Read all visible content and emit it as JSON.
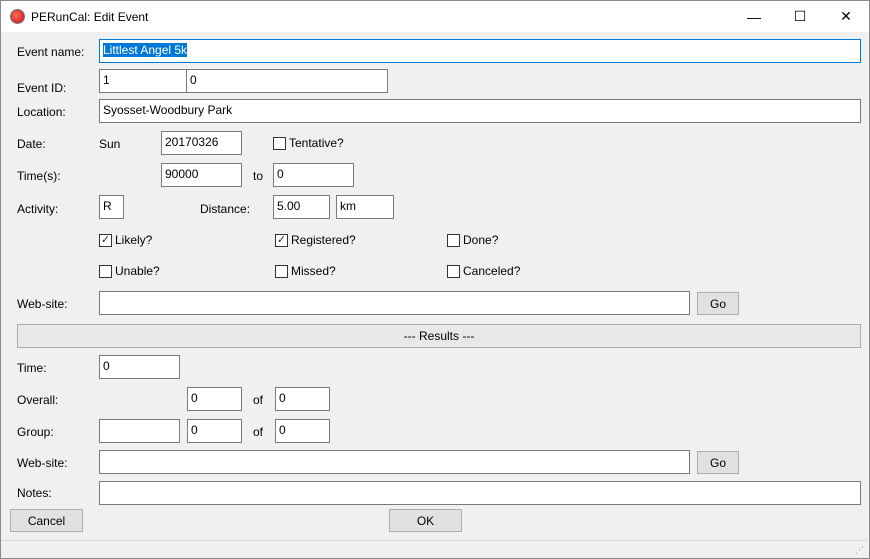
{
  "window": {
    "title": "PERunCal: Edit Event",
    "minimize": "—",
    "maximize": "☐",
    "close": "✕"
  },
  "form": {
    "event_name_label": "Event name:",
    "event_name": "Littlest Angel 5k",
    "event_id_label": "Event ID:",
    "event_id_1": "1",
    "event_id_2": "0",
    "location_label": "Location:",
    "location": "Syosset-Woodbury Park",
    "date_label": "Date:",
    "day": "Sun",
    "date": "20170326",
    "tentative": {
      "label": "Tentative?",
      "checked": false
    },
    "times_label": "Time(s):",
    "time_from": "90000",
    "to_label": "to",
    "time_to": "0",
    "activity_label": "Activity:",
    "activity": "R",
    "distance_label": "Distance:",
    "distance": "5.00",
    "unit": "km",
    "checkboxes": [
      {
        "label": "Likely?",
        "checked": true
      },
      {
        "label": "Registered?",
        "checked": true
      },
      {
        "label": "Done?",
        "checked": false
      },
      {
        "label": "Unable?",
        "checked": false
      },
      {
        "label": "Missed?",
        "checked": false
      },
      {
        "label": "Canceled?",
        "checked": false
      }
    ],
    "website_label": "Web-site:",
    "website": "",
    "go_label": "Go"
  },
  "results": {
    "header": "--- Results ---",
    "time_label": "Time:",
    "time": "0",
    "overall_label": "Overall:",
    "overall": "0",
    "of_label": "of",
    "overall_of": "0",
    "group_label": "Group:",
    "group_name": "",
    "group": "0",
    "group_of": "0",
    "website_label": "Web-site:",
    "website": "",
    "go_label": "Go",
    "notes_label": "Notes:",
    "notes": ""
  },
  "buttons": {
    "cancel": "Cancel",
    "ok": "OK"
  }
}
